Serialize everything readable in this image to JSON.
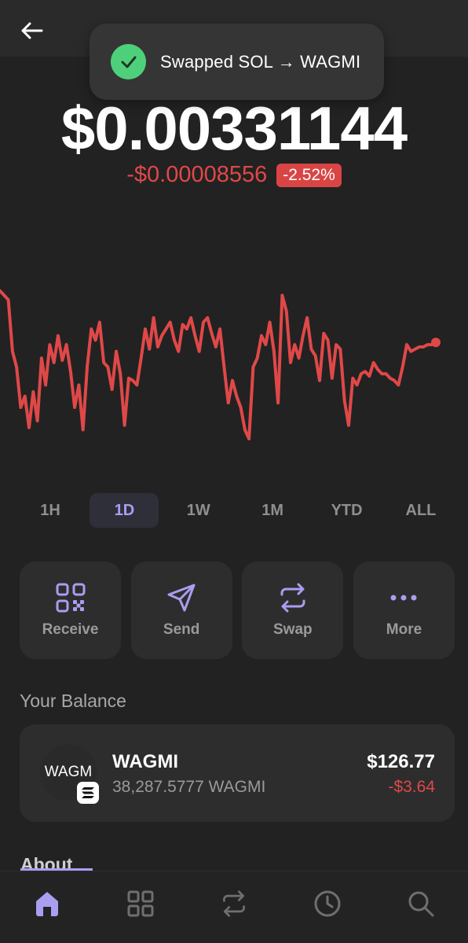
{
  "toast": {
    "message": "Swapped SOL → WAGMI",
    "icon": "check-icon"
  },
  "header": {
    "back_icon": "arrow-left-icon"
  },
  "price": {
    "value": "$0.00331144",
    "change_abs": "-$0.00008556",
    "change_pct": "-2.52%"
  },
  "colors": {
    "accent": "#a99ef0",
    "negative": "#e04848",
    "success": "#4ed07a",
    "background": "#222222",
    "card": "#2d2d2d"
  },
  "chart_data": {
    "type": "line",
    "series": [
      {
        "values": [
          0.72,
          0.7,
          0.68,
          0.45,
          0.38,
          0.2,
          0.25,
          0.11,
          0.27,
          0.14,
          0.42,
          0.3,
          0.48,
          0.4,
          0.52,
          0.41,
          0.48,
          0.36,
          0.2,
          0.3,
          0.1,
          0.38,
          0.55,
          0.5,
          0.58,
          0.4,
          0.38,
          0.28,
          0.45,
          0.35,
          0.12,
          0.33,
          0.32,
          0.3,
          0.42,
          0.55,
          0.46,
          0.6,
          0.47,
          0.52,
          0.55,
          0.58,
          0.5,
          0.45,
          0.57,
          0.55,
          0.6,
          0.52,
          0.45,
          0.58,
          0.6,
          0.53,
          0.47,
          0.55,
          0.38,
          0.22,
          0.32,
          0.25,
          0.2,
          0.1,
          0.06,
          0.38,
          0.42,
          0.52,
          0.48,
          0.58,
          0.45,
          0.22,
          0.7,
          0.63,
          0.4,
          0.48,
          0.42,
          0.52,
          0.6,
          0.46,
          0.43,
          0.32,
          0.53,
          0.5,
          0.33,
          0.48,
          0.46,
          0.23,
          0.12,
          0.33,
          0.3,
          0.35,
          0.36,
          0.34,
          0.4,
          0.37,
          0.35,
          0.35,
          0.33,
          0.32,
          0.3,
          0.38,
          0.48,
          0.45,
          0.46,
          0.47,
          0.47,
          0.48,
          0.48,
          0.49
        ]
      }
    ],
    "range": "1D",
    "grid": false,
    "color": "#e04848"
  },
  "ranges": [
    {
      "label": "1H",
      "active": false
    },
    {
      "label": "1D",
      "active": true
    },
    {
      "label": "1W",
      "active": false
    },
    {
      "label": "1M",
      "active": false
    },
    {
      "label": "YTD",
      "active": false
    },
    {
      "label": "ALL",
      "active": false
    }
  ],
  "actions": [
    {
      "label": "Receive",
      "icon": "qr-code-icon"
    },
    {
      "label": "Send",
      "icon": "send-icon"
    },
    {
      "label": "Swap",
      "icon": "swap-icon"
    },
    {
      "label": "More",
      "icon": "more-icon"
    }
  ],
  "balance": {
    "title": "Your Balance",
    "token": {
      "avatar_text": "WAGM",
      "name": "WAGMI",
      "amount": "38,287.5777 WAGMI",
      "value": "$126.77",
      "change": "-$3.64",
      "chain_icon": "solana-icon"
    }
  },
  "about": {
    "title": "About"
  },
  "nav": [
    {
      "name": "home",
      "icon": "home-icon",
      "active": true
    },
    {
      "name": "collectibles",
      "icon": "grid-icon",
      "active": false
    },
    {
      "name": "swap",
      "icon": "swap-icon",
      "active": false
    },
    {
      "name": "activity",
      "icon": "clock-icon",
      "active": false
    },
    {
      "name": "search",
      "icon": "search-icon",
      "active": false
    }
  ]
}
